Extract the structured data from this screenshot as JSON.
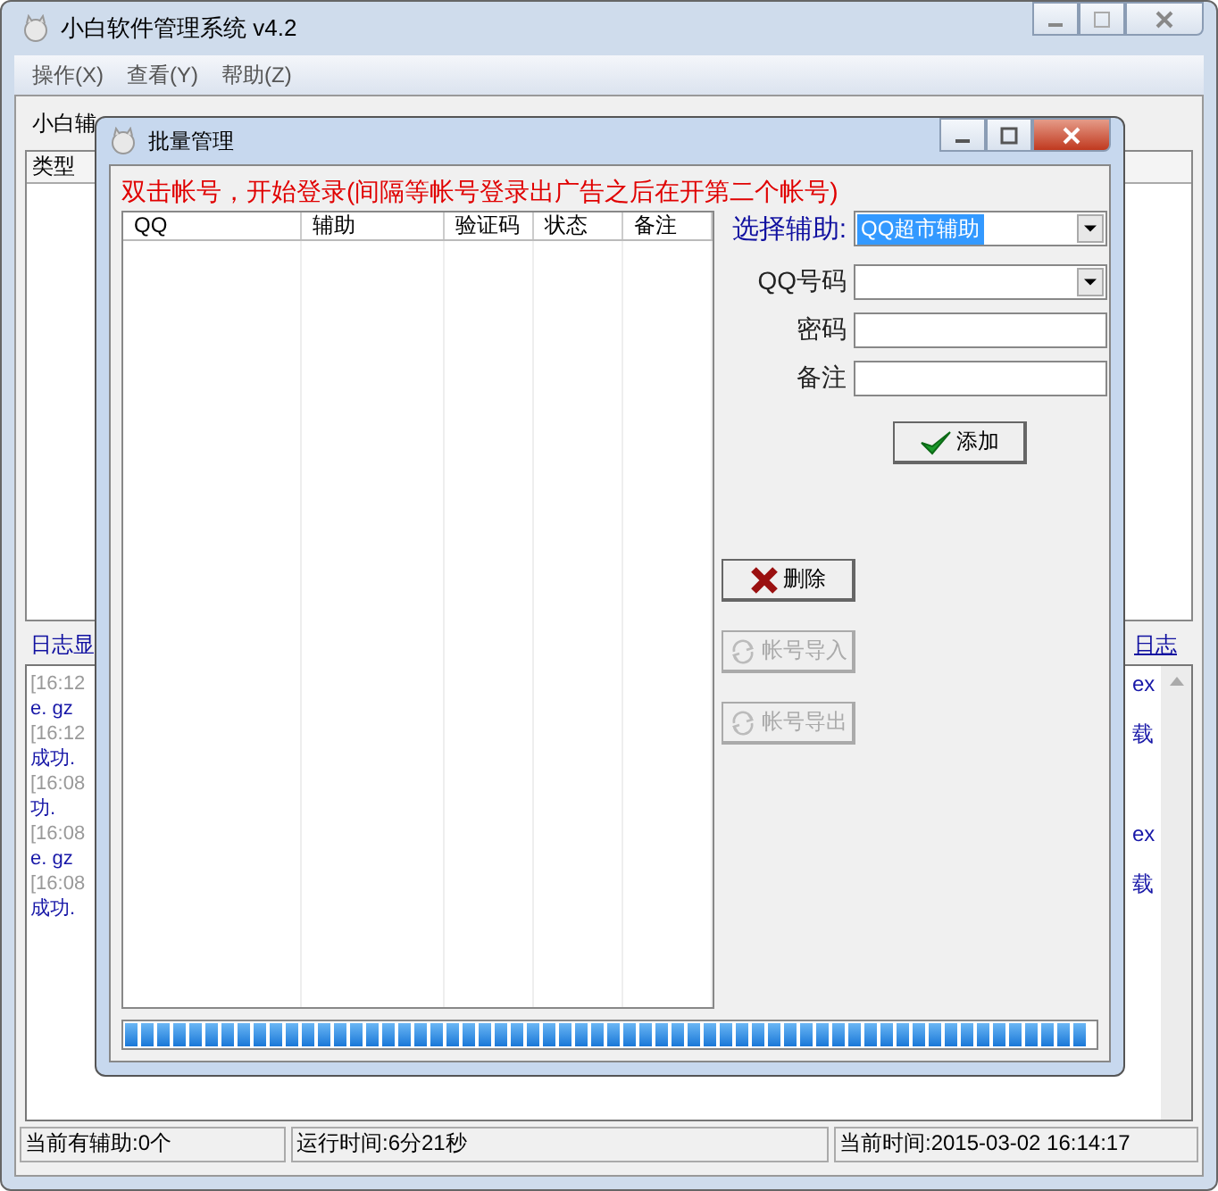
{
  "window": {
    "title": "小白软件管理系统   v4.2"
  },
  "menu": [
    "操作(X)",
    "查看(Y)",
    "帮助(Z)"
  ],
  "toolbar_label": "小白辅",
  "table": {
    "columns": [
      "类型"
    ]
  },
  "log": {
    "tab": "日志显",
    "link": "日志",
    "rows": [
      {
        "kind": "time",
        "start": "[16:12",
        "end": "ex"
      },
      {
        "kind": "message",
        "start": "e. gz"
      },
      {
        "kind": "time",
        "start": "[16:12",
        "end": "载"
      },
      {
        "kind": "message",
        "start": "成功."
      },
      {
        "kind": "time",
        "start": "[16:08"
      },
      {
        "kind": "message",
        "start": "功."
      },
      {
        "kind": "time",
        "start": "[16:08",
        "end": "ex"
      },
      {
        "kind": "message",
        "start": "e. gz"
      },
      {
        "kind": "time",
        "start": "[16:08",
        "end": "载"
      },
      {
        "kind": "message",
        "start": "成功."
      }
    ]
  },
  "status_bar": [
    "当前有辅助:0个",
    "运行时间:6分21秒",
    "当前时间:2015-03-02 16:14:17"
  ],
  "dialog": {
    "title": "批量管理",
    "notice": "双击帐号，开始登录(间隔等帐号登录出广告之后在开第二个帐号)",
    "list": {
      "columns": [
        "QQ",
        "辅助",
        "验证码",
        "状态",
        "备注"
      ]
    },
    "form": [
      {
        "label": "选择辅助:",
        "kind": "dropdown",
        "value": "QQ超市辅助"
      },
      {
        "label": "QQ号码",
        "kind": "dropdown"
      },
      {
        "label": "密码",
        "kind": "text"
      },
      {
        "label": "备注",
        "kind": "text"
      }
    ],
    "buttons": [
      {
        "label": "添加",
        "kind": "add",
        "disabled": false
      },
      {
        "label": "删除",
        "kind": "delete",
        "disabled": false
      },
      {
        "label": "帐号导入",
        "kind": "import",
        "disabled": true
      },
      {
        "label": "帐号导出",
        "kind": "export",
        "disabled": true
      }
    ],
    "progress": {
      "level": 1
    }
  }
}
